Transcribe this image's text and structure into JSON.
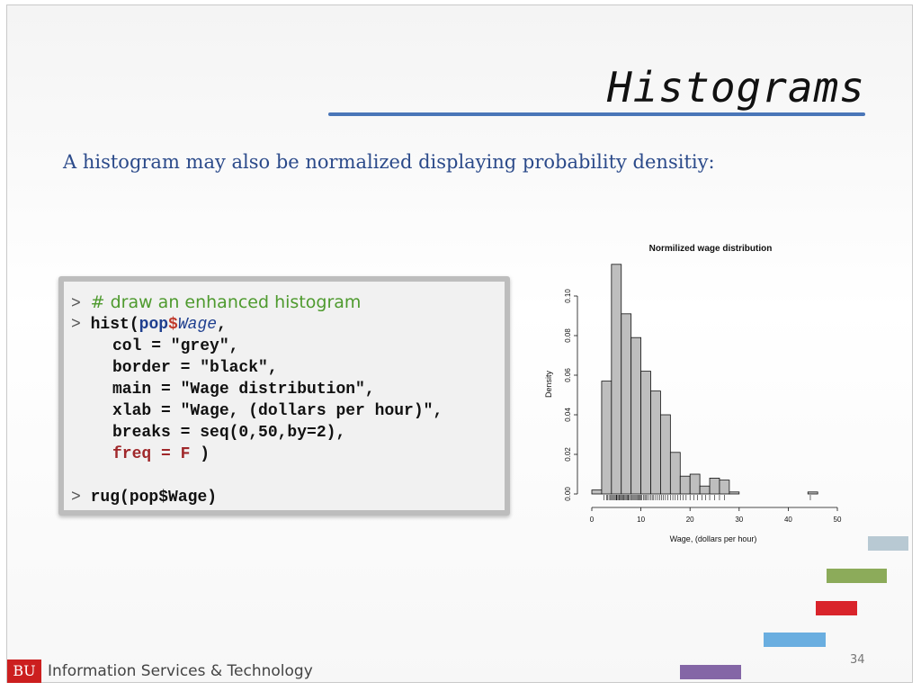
{
  "slide": {
    "title": "Histograms",
    "subtitle": "A histogram may also be normalized displaying probability densitiy:",
    "page_number": "34"
  },
  "code": {
    "prompt": ">",
    "comment": "# draw an enhanced histogram",
    "line_hist_fn": "hist(",
    "line_hist_obj": "pop",
    "line_hist_dollar": "$",
    "line_hist_field": "Wage",
    "line_hist_comma": ",",
    "line_col": "col = \"grey\",",
    "line_border": "border = \"black\",",
    "line_main": "main = \"Wage distribution\",",
    "line_xlab": "xlab = \"Wage, (dollars per hour)\",",
    "line_breaks": "breaks = seq(0,50,by=2),",
    "line_freq": "freq = F",
    "line_freq_close": " )",
    "line_rug": "rug(pop$Wage)"
  },
  "footer": {
    "logo": "BU",
    "org": "Information Services & Technology"
  },
  "colors": {
    "title_rule": "#4a76b8",
    "subtitle": "#2b4a8a",
    "bar_fill": "#bebebe",
    "deco": [
      "#b8c9d3",
      "#8cab5a",
      "#d9242b",
      "#6aaee0",
      "#8466a6"
    ]
  },
  "chart_data": {
    "type": "bar",
    "title": "Normilized wage distribution",
    "xlabel": "Wage, (dollars per hour)",
    "ylabel": "Density",
    "bin_edges": [
      0,
      2,
      4,
      6,
      8,
      10,
      12,
      14,
      16,
      18,
      20,
      22,
      24,
      26,
      28,
      30,
      32,
      34,
      36,
      38,
      40,
      42,
      44,
      46,
      48,
      50
    ],
    "values": [
      0.002,
      0.057,
      0.116,
      0.091,
      0.079,
      0.062,
      0.052,
      0.04,
      0.021,
      0.009,
      0.01,
      0.004,
      0.008,
      0.007,
      0.001,
      0,
      0,
      0,
      0,
      0,
      0,
      0,
      0.001,
      0,
      0
    ],
    "xlim": [
      0,
      50
    ],
    "ylim": [
      0,
      0.11
    ],
    "xticks": [
      "0",
      "10",
      "20",
      "30",
      "40",
      "50"
    ],
    "yticks": [
      "0.00",
      "0.02",
      "0.04",
      "0.06",
      "0.08",
      "0.10"
    ],
    "rug": [
      2.5,
      3,
      3.2,
      3.5,
      3.8,
      4,
      4.2,
      4.4,
      4.6,
      4.8,
      5,
      5.1,
      5.3,
      5.5,
      5.6,
      5.8,
      6,
      6.1,
      6.3,
      6.5,
      6.6,
      6.8,
      7,
      7.2,
      7.4,
      7.5,
      7.7,
      8,
      8.2,
      8.4,
      8.6,
      8.8,
      9,
      9.2,
      9.4,
      9.6,
      9.8,
      10,
      10.2,
      10.5,
      10.8,
      11,
      11.3,
      11.6,
      12,
      12.3,
      12.6,
      13,
      13.4,
      13.8,
      14.2,
      14.6,
      15,
      15.5,
      16,
      16.5,
      17,
      17.5,
      18,
      18.6,
      19.2,
      20,
      20.8,
      21.5,
      22.4,
      23.2,
      24,
      25,
      26,
      27,
      44.5
    ]
  }
}
